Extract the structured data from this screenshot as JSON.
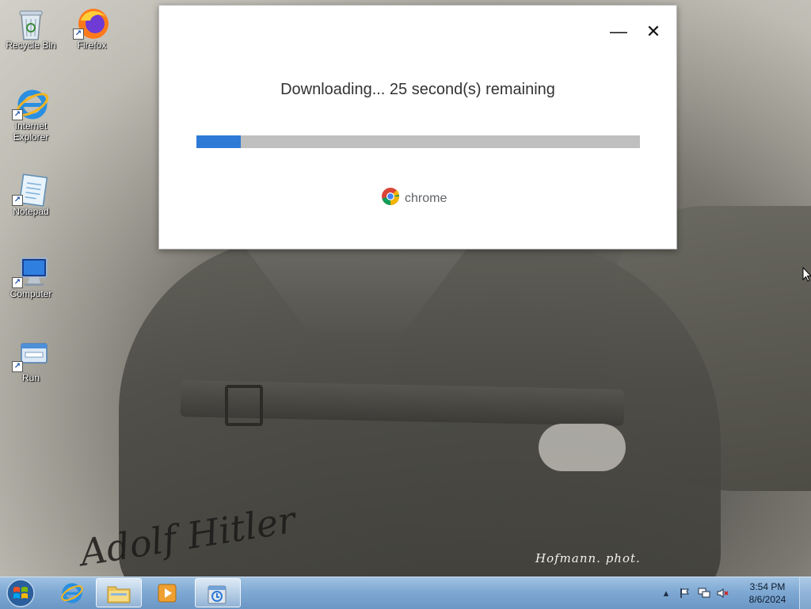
{
  "desktop": {
    "icons": [
      {
        "label": "Recycle Bin",
        "icon": "recycle-bin-icon",
        "shortcut": false
      },
      {
        "label": "Firefox",
        "icon": "firefox-icon",
        "shortcut": true
      },
      {
        "label": "Internet Explorer",
        "icon": "internet-explorer-icon",
        "shortcut": true
      },
      {
        "label": "Notepad",
        "icon": "notepad-icon",
        "shortcut": true
      },
      {
        "label": "Computer",
        "icon": "computer-icon",
        "shortcut": true
      },
      {
        "label": "Run",
        "icon": "run-icon",
        "shortcut": true
      }
    ],
    "wallpaper": {
      "photo_credit": "Hofmann. phot.",
      "signature": "Adolf Hitler"
    }
  },
  "dialog": {
    "status_text": "Downloading... 25 second(s) remaining",
    "progress_fraction": 0.1,
    "brand_name": "chrome",
    "minimize_symbol": "—",
    "close_symbol": "✕",
    "progress_color": "#2d7ad6",
    "track_color": "#bfbfbf"
  },
  "taskbar": {
    "start": {
      "icon": "windows-start-icon"
    },
    "pinned": [
      {
        "name": "internet-explorer",
        "icon": "internet-explorer-icon",
        "active": false
      },
      {
        "name": "file-explorer",
        "icon": "folder-icon",
        "active": true
      },
      {
        "name": "media-player",
        "icon": "media-player-icon",
        "active": false
      },
      {
        "name": "chrome-installer",
        "icon": "installer-icon",
        "active": true
      }
    ],
    "tray": {
      "icons": [
        "show-hidden-icons-icon",
        "action-center-flag-icon",
        "network-icon",
        "volume-muted-icon"
      ],
      "time": "3:54 PM",
      "date": "8/6/2024"
    }
  }
}
